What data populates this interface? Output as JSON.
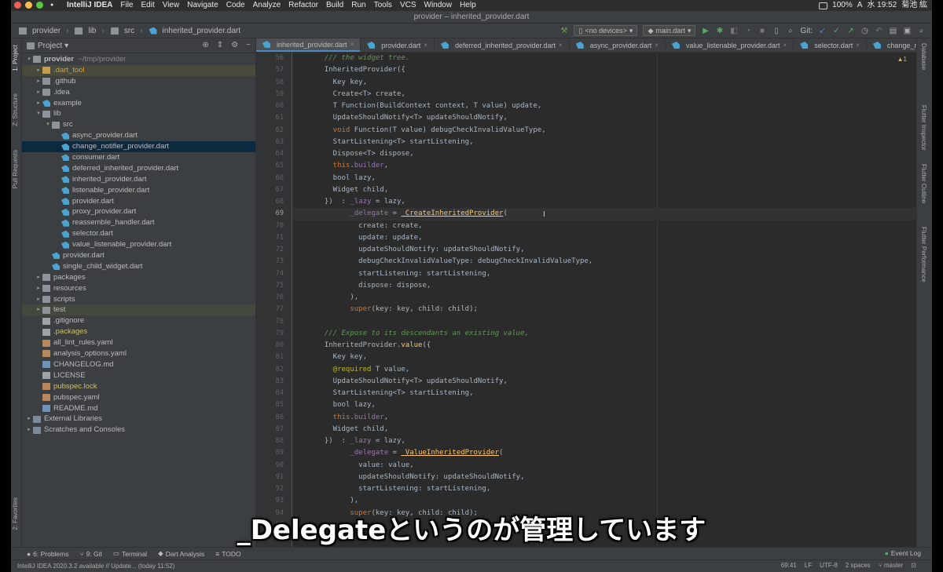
{
  "menubar": {
    "app": "IntelliJ IDEA",
    "items": [
      "File",
      "Edit",
      "View",
      "Navigate",
      "Code",
      "Analyze",
      "Refactor",
      "Build",
      "Run",
      "Tools",
      "VCS",
      "Window",
      "Help"
    ],
    "battery": "100%",
    "ime": "A",
    "datetime": "水 19:52",
    "user": "菊池 紘"
  },
  "window_title": "provider – inherited_provider.dart",
  "breadcrumbs": [
    "provider",
    "lib",
    "src",
    "inherited_provider.dart"
  ],
  "nav": {
    "device": "<no devices>",
    "run_config": "main.dart",
    "git_label": "Git:"
  },
  "project_panel": {
    "title": "Project"
  },
  "tree": [
    {
      "label": "provider",
      "suffix": "~/tmp/provider",
      "depth": 0,
      "arrow": "▾",
      "icon": "fold",
      "bold": true
    },
    {
      "label": ".dart_tool",
      "depth": 1,
      "arrow": "▸",
      "icon": "foldo",
      "style": "orange",
      "bg": "excl"
    },
    {
      "label": ".github",
      "depth": 1,
      "arrow": "▸",
      "icon": "fold"
    },
    {
      "label": ".idea",
      "depth": 1,
      "arrow": "▸",
      "icon": "fold"
    },
    {
      "label": "example",
      "depth": 1,
      "arrow": "▸",
      "icon": "dart"
    },
    {
      "label": "lib",
      "depth": 1,
      "arrow": "▾",
      "icon": "fold"
    },
    {
      "label": "src",
      "depth": 2,
      "arrow": "▾",
      "icon": "fold"
    },
    {
      "label": "async_provider.dart",
      "depth": 3,
      "icon": "dart"
    },
    {
      "label": "change_notifier_provider.dart",
      "depth": 3,
      "icon": "dart",
      "bg": "sel"
    },
    {
      "label": "consumer.dart",
      "depth": 3,
      "icon": "dart"
    },
    {
      "label": "deferred_inherited_provider.dart",
      "depth": 3,
      "icon": "dart"
    },
    {
      "label": "inherited_provider.dart",
      "depth": 3,
      "icon": "dart"
    },
    {
      "label": "listenable_provider.dart",
      "depth": 3,
      "icon": "dart"
    },
    {
      "label": "provider.dart",
      "depth": 3,
      "icon": "dart"
    },
    {
      "label": "proxy_provider.dart",
      "depth": 3,
      "icon": "dart"
    },
    {
      "label": "reassemble_handler.dart",
      "depth": 3,
      "icon": "dart"
    },
    {
      "label": "selector.dart",
      "depth": 3,
      "icon": "dart"
    },
    {
      "label": "value_listenable_provider.dart",
      "depth": 3,
      "icon": "dart"
    },
    {
      "label": "provider.dart",
      "depth": 2,
      "icon": "dart"
    },
    {
      "label": "single_child_widget.dart",
      "depth": 2,
      "icon": "dart"
    },
    {
      "label": "packages",
      "depth": 1,
      "arrow": "▸",
      "icon": "fold"
    },
    {
      "label": "resources",
      "depth": 1,
      "arrow": "▸",
      "icon": "fold"
    },
    {
      "label": "scripts",
      "depth": 1,
      "arrow": "▸",
      "icon": "fold"
    },
    {
      "label": "test",
      "depth": 1,
      "arrow": "▸",
      "icon": "fold",
      "bg": "test"
    },
    {
      "label": ".gitignore",
      "depth": 1,
      "icon": "txt"
    },
    {
      "label": ".packages",
      "depth": 1,
      "icon": "txt",
      "style": "yell"
    },
    {
      "label": "all_lint_rules.yaml",
      "depth": 1,
      "icon": "yaml"
    },
    {
      "label": "analysis_options.yaml",
      "depth": 1,
      "icon": "yaml"
    },
    {
      "label": "CHANGELOG.md",
      "depth": 1,
      "icon": "md"
    },
    {
      "label": "LICENSE",
      "depth": 1,
      "icon": "txt"
    },
    {
      "label": "pubspec.lock",
      "depth": 1,
      "icon": "yaml",
      "style": "yell"
    },
    {
      "label": "pubspec.yaml",
      "depth": 1,
      "icon": "yaml"
    },
    {
      "label": "README.md",
      "depth": 1,
      "icon": "md"
    },
    {
      "label": "External Libraries",
      "depth": 0,
      "arrow": "▸",
      "icon": "lib"
    },
    {
      "label": "Scratches and Consoles",
      "depth": 0,
      "arrow": "▸",
      "icon": "lib"
    }
  ],
  "tabs": [
    {
      "label": "inherited_provider.dart",
      "active": true
    },
    {
      "label": "provider.dart"
    },
    {
      "label": "deferred_inherited_provider.dart"
    },
    {
      "label": "async_provider.dart"
    },
    {
      "label": "value_listenable_provider.dart"
    },
    {
      "label": "selector.dart"
    },
    {
      "label": "change_notifier_provider.dar"
    }
  ],
  "editor": {
    "first_line": 56,
    "current_line": 69,
    "warnings": "▲1",
    "lines": [
      [
        [
          2,
          "/// the widget tree.",
          "cm"
        ]
      ],
      [
        [
          2,
          "InheritedProvider({",
          ""
        ]
      ],
      [
        [
          4,
          "Key key,",
          ""
        ]
      ],
      [
        [
          4,
          "Create<T> create,",
          ""
        ]
      ],
      [
        [
          4,
          "T Function(BuildContext context, T value) update,",
          ""
        ]
      ],
      [
        [
          4,
          "UpdateShouldNotify<T> updateShouldNotify,",
          ""
        ]
      ],
      [
        [
          4,
          "void",
          "kw"
        ],
        [
          0,
          " Function(T value) debugCheckInvalidValueType,",
          ""
        ]
      ],
      [
        [
          4,
          "StartListening<T> startListening,",
          ""
        ]
      ],
      [
        [
          4,
          "Dispose<T> dispose,",
          ""
        ]
      ],
      [
        [
          4,
          "this",
          "kw"
        ],
        [
          0,
          ".",
          ""
        ],
        [
          0,
          "builder",
          "fld"
        ],
        [
          0,
          ",",
          ""
        ]
      ],
      [
        [
          4,
          "bool lazy,",
          ""
        ]
      ],
      [
        [
          4,
          "Widget child,",
          ""
        ]
      ],
      [
        [
          2,
          "})  : ",
          ""
        ],
        [
          0,
          "_lazy",
          "fld"
        ],
        [
          0,
          " = lazy,",
          ""
        ]
      ],
      [
        [
          8,
          "_delegate",
          "fld"
        ],
        [
          0,
          " = ",
          ""
        ],
        [
          0,
          "_CreateInheritedProvider",
          "fn u"
        ],
        [
          0,
          "(",
          ""
        ]
      ],
      [
        [
          10,
          "create: create,",
          ""
        ]
      ],
      [
        [
          10,
          "update: update,",
          ""
        ]
      ],
      [
        [
          10,
          "updateShouldNotify: updateShouldNotify,",
          ""
        ]
      ],
      [
        [
          10,
          "debugCheckInvalidValueType: debugCheckInvalidValueType,",
          ""
        ]
      ],
      [
        [
          10,
          "startListening: startListening,",
          ""
        ]
      ],
      [
        [
          10,
          "dispose: dispose,",
          ""
        ]
      ],
      [
        [
          8,
          "),",
          ""
        ]
      ],
      [
        [
          8,
          "super",
          "kw"
        ],
        [
          0,
          "(key: key, child: child);",
          ""
        ]
      ],
      [
        [
          0,
          "",
          ""
        ]
      ],
      [
        [
          2,
          "/// Expose to its descendants an existing value,",
          "cm"
        ]
      ],
      [
        [
          2,
          "InheritedProvider.",
          ""
        ],
        [
          0,
          "value",
          "fn"
        ],
        [
          0,
          "({",
          ""
        ]
      ],
      [
        [
          4,
          "Key key,",
          ""
        ]
      ],
      [
        [
          4,
          "@required",
          "ann"
        ],
        [
          0,
          " T value,",
          ""
        ]
      ],
      [
        [
          4,
          "UpdateShouldNotify<T> updateShouldNotify,",
          ""
        ]
      ],
      [
        [
          4,
          "StartListening<T> startListening,",
          ""
        ]
      ],
      [
        [
          4,
          "bool lazy,",
          ""
        ]
      ],
      [
        [
          4,
          "this",
          "kw"
        ],
        [
          0,
          ".",
          ""
        ],
        [
          0,
          "builder",
          "fld"
        ],
        [
          0,
          ",",
          ""
        ]
      ],
      [
        [
          4,
          "Widget child,",
          ""
        ]
      ],
      [
        [
          2,
          "})  : ",
          ""
        ],
        [
          0,
          "_lazy",
          "fld"
        ],
        [
          0,
          " = lazy,",
          ""
        ]
      ],
      [
        [
          8,
          "_delegate",
          "fld"
        ],
        [
          0,
          " = ",
          ""
        ],
        [
          0,
          "_ValueInheritedProvider",
          "fn u"
        ],
        [
          0,
          "(",
          ""
        ]
      ],
      [
        [
          10,
          "value: value,",
          ""
        ]
      ],
      [
        [
          10,
          "updateShouldNotify: updateShouldNotify,",
          ""
        ]
      ],
      [
        [
          10,
          "startListening: startListening,",
          ""
        ]
      ],
      [
        [
          8,
          "),",
          ""
        ]
      ],
      [
        [
          8,
          "super",
          "kw"
        ],
        [
          0,
          "(key: key, child: child);",
          ""
        ]
      ],
      [
        [
          0,
          "",
          ""
        ]
      ],
      [
        [
          2,
          "",
          ""
        ]
      ]
    ]
  },
  "subtitle": "_Delegateというのが管理しています",
  "left_tabs": [
    "1: Project",
    "Z: Structure",
    "Pull Requests",
    "2: Favorites"
  ],
  "right_tabs": [
    "Database",
    "Flutter Inspector",
    "Flutter Outline",
    "Flutter Performance"
  ],
  "bottom_tools": [
    "6: Problems",
    "9: Git",
    "Terminal",
    "Dart Analysis",
    "TODO"
  ],
  "event_log": "Event Log",
  "status": {
    "message": "IntelliJ IDEA 2020.3.2 available // Update... (today 11:52)",
    "position": "69:41",
    "line_sep": "LF",
    "encoding": "UTF-8",
    "indent": "2 spaces",
    "branch": "master"
  },
  "colors": {
    "accent": "#4a88c7",
    "keyword": "#cc7832",
    "comment": "#629755",
    "function": "#ffc66d",
    "field": "#9876aa"
  }
}
